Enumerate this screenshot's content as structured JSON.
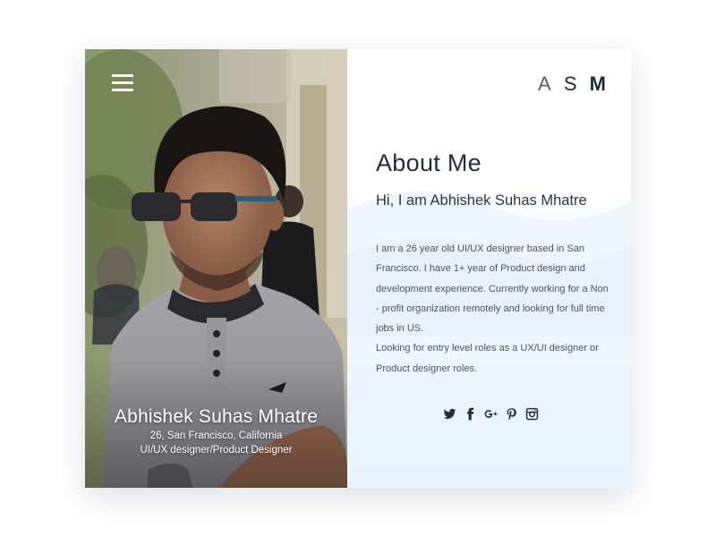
{
  "profile": {
    "name": "Abhishek Suhas Mhatre",
    "details": "26, San Francisco, California",
    "role": "UI/UX designer/Product Designer"
  },
  "header": {
    "logo_letters": [
      "A",
      "S",
      "M"
    ],
    "menu_icon": "hamburger-menu-icon"
  },
  "about": {
    "title": "About Me",
    "greeting": "Hi, I am Abhishek Suhas Mhatre",
    "bio_paragraphs": [
      "I am a 26 year old UI/UX designer based in San Francisco. I have 1+ year of Product design and development experience.  Currently working for a Non - profit organization remotely and looking for full time jobs in US.",
      "Looking for entry level roles as a UX/UI designer or Product designer roles."
    ]
  },
  "social": [
    {
      "icon": "twitter-icon"
    },
    {
      "icon": "facebook-icon"
    },
    {
      "icon": "google-plus-icon"
    },
    {
      "icon": "pinterest-icon"
    },
    {
      "icon": "instagram-icon"
    }
  ],
  "colors": {
    "text_dark": "#1f2d40",
    "panel_gradient_end": "#e8f3fd",
    "photo_text": "#ffffff"
  }
}
